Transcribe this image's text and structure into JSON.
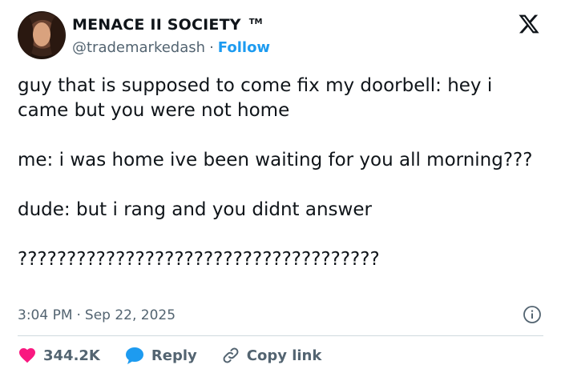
{
  "author": {
    "display_name": "MENACE II SOCIETY",
    "badge": "TM",
    "handle": "@trademarkedash",
    "separator": "·",
    "follow_label": "Follow"
  },
  "tweet": {
    "text": "guy that is supposed to come fix my doorbell: hey i came but you were not home\n\nme: i was home ive been waiting for you all morning???\n\ndude: but i rang and you didnt answer\n\n?????????????????????????????????????"
  },
  "meta": {
    "time": "3:04 PM",
    "separator": "·",
    "date": "Sep 22, 2025"
  },
  "actions": {
    "like_count": "344.2K",
    "reply_label": "Reply",
    "copy_link_label": "Copy link"
  },
  "colors": {
    "accent": "#1d9bf0",
    "like": "#f91880",
    "text": "#0f1419",
    "muted": "#536471"
  },
  "icons": {
    "logo": "x-logo-icon",
    "info": "info-icon",
    "like": "heart-icon",
    "reply": "reply-bubble-icon",
    "copy": "link-icon"
  }
}
